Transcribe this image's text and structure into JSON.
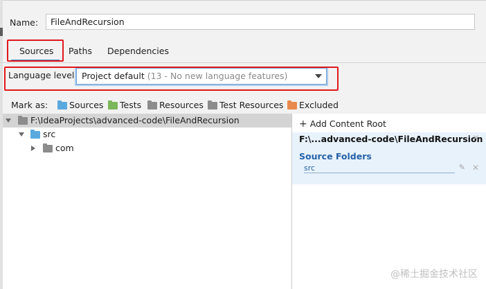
{
  "name_label": "Name:",
  "name_value": "FileAndRecursion",
  "tabs": [
    {
      "label": "Sources"
    },
    {
      "label": "Paths"
    },
    {
      "label": "Dependencies"
    }
  ],
  "language_level": {
    "label": "Language level:",
    "value": "Project default",
    "hint": "(13 - No new language features)"
  },
  "mark_as": {
    "label": "Mark as:",
    "items": [
      {
        "label": "Sources",
        "color": "#5aa9de"
      },
      {
        "label": "Tests",
        "color": "#7cb65a"
      },
      {
        "label": "Resources",
        "color": "#8c8c8c"
      },
      {
        "label": "Test Resources",
        "color": "#8c8c8c"
      },
      {
        "label": "Excluded",
        "color": "#e88a4d"
      }
    ]
  },
  "tree": {
    "root": "F:\\IdeaProjects\\advanced-code\\FileAndRecursion",
    "src": "src",
    "com": "com"
  },
  "right": {
    "add_content_root": "Add Content Root",
    "root_path": "F:\\...advanced-code\\FileAndRecursion",
    "source_folders_heading": "Source Folders",
    "source_folder_item": "src"
  },
  "watermark": "@稀土掘金技术社区",
  "colors": {
    "accent": "#4083c9",
    "annotation_red": "#e0171c",
    "selection": "#d4d4d4",
    "root_panel": "#e8f2fb",
    "source_folder_text": "#2462a8"
  },
  "icons": [
    "folder-icon",
    "plus-icon",
    "close-icon",
    "edit-icon",
    "chevron-down-icon",
    "expand-arrow-icon"
  ]
}
